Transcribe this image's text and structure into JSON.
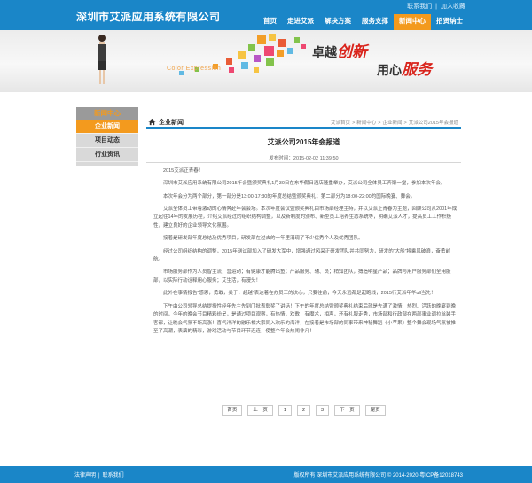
{
  "header": {
    "brand": "深圳市艾派应用系统有限公司",
    "links": [
      "联系我们",
      "加入收藏"
    ],
    "nav": [
      {
        "label": "首页",
        "active": false
      },
      {
        "label": "走进艾派",
        "active": false
      },
      {
        "label": "解决方案",
        "active": false
      },
      {
        "label": "服务支撑",
        "active": false
      },
      {
        "label": "新闻中心",
        "active": true
      },
      {
        "label": "招贤纳士",
        "active": false
      }
    ]
  },
  "banner": {
    "slogan1_prefix": "卓越",
    "slogan1_highlight": "创新",
    "slogan2_prefix": "用心",
    "slogan2_highlight": "服务",
    "color_expression": "Color Expression"
  },
  "sidebar": {
    "heading": "新闻中心",
    "items": [
      {
        "label": "企业新闻",
        "active": true
      },
      {
        "label": "项目动态",
        "active": false
      },
      {
        "label": "行业资讯",
        "active": false
      }
    ]
  },
  "main": {
    "section_title": "企业新闻",
    "breadcrumb": [
      "艾派首页",
      "新闻中心",
      "企业新闻",
      "艾派公司2015年会报道"
    ],
    "breadcrumb_sep": ">",
    "article_title": "艾派公司2015年会报道",
    "publish_date": "发布时间：2015-02-02 11:39:50",
    "paragraphs": [
      "2015艾派正青春！",
      "深圳市艾派应用系统有限公司2015年会暨颁奖典礼1月30日在东华假日酒店隆重举办，艾派公司全体员工齐聚一堂，参加本次年会。",
      "本次年会分为两个部分，第一部分是13:00-17:30的年度总结暨颁奖典礼；第二部分为18:00-22:00的国际晚宴、舞会。",
      "艾派全体员工带着激动的心情奔赴年会会场。本次年度会议暨颁奖典礼由市场部经理主持，并以艾派正青春为主题，回顾公司从2001年成立起往14年的发展历程，介绍艾派经过的组织结构调整，以及新制度的颁布、新型员工培养生态系统等，明确艾派人才，提高员工工作积极性，建立良好的企业领导文化氛围。",
      "接着是研发部年度总结及优秀项目，研发部在过去的一年里涌现了不少优秀个人及优秀团队。",
      "经过公司组织结构的调整，2015年测试部加入了研发大军中，增强通过风采正研发团队并共同努力，研发的“大船”将乘风破浪，奋勇前航。",
      "市场服务部作为人员智主流，营运动；有健康才能腾出鱼；产品服务、辅、员；稍知团队，搏造明星产品；品牌与用户服务部们全用服部，以实际行动诠释用心服务；艾生活，有漫头！",
      "此外在事情报告“感恩，勇敢，关于，超越”表达着在办员工的决心，只要往前，今天永远都是起跑线，2015行艾派年华ull当先！",
      "下午由公司领导总结提振性经年先主先到门批表彰奖了讲话！下午的年度总结暨颁奖典礼结束后就是先满了激情、热烈、活跃的晚宴到晚的时间，今年的晚会节目精彩纷呈，是通过项目观察，有热情，欢歌！有魔术，相声，还有礼服走秀，市场部和行政部在两部事业调拉丝装手客都，让晚会气氛不断高涨！喜气洋洋的融乐相大家同入欢乐的海洋，在接着是市场部的同事带来神秘舞蹈《小苹果》整个舞会现场气氛被推至了高潮，表演的精彩，游戏活动与节目环节连连，使整个年会热闹非凡！"
    ],
    "pager": [
      "首页",
      "上一页",
      "1",
      "2",
      "3",
      "下一页",
      "尾页"
    ]
  },
  "footer": {
    "links": [
      "法律声明",
      "联系我们"
    ],
    "copyright": "版权所有  深圳市艾派应用系统有限公司 © 2014-2020   粤ICP备12018743"
  }
}
